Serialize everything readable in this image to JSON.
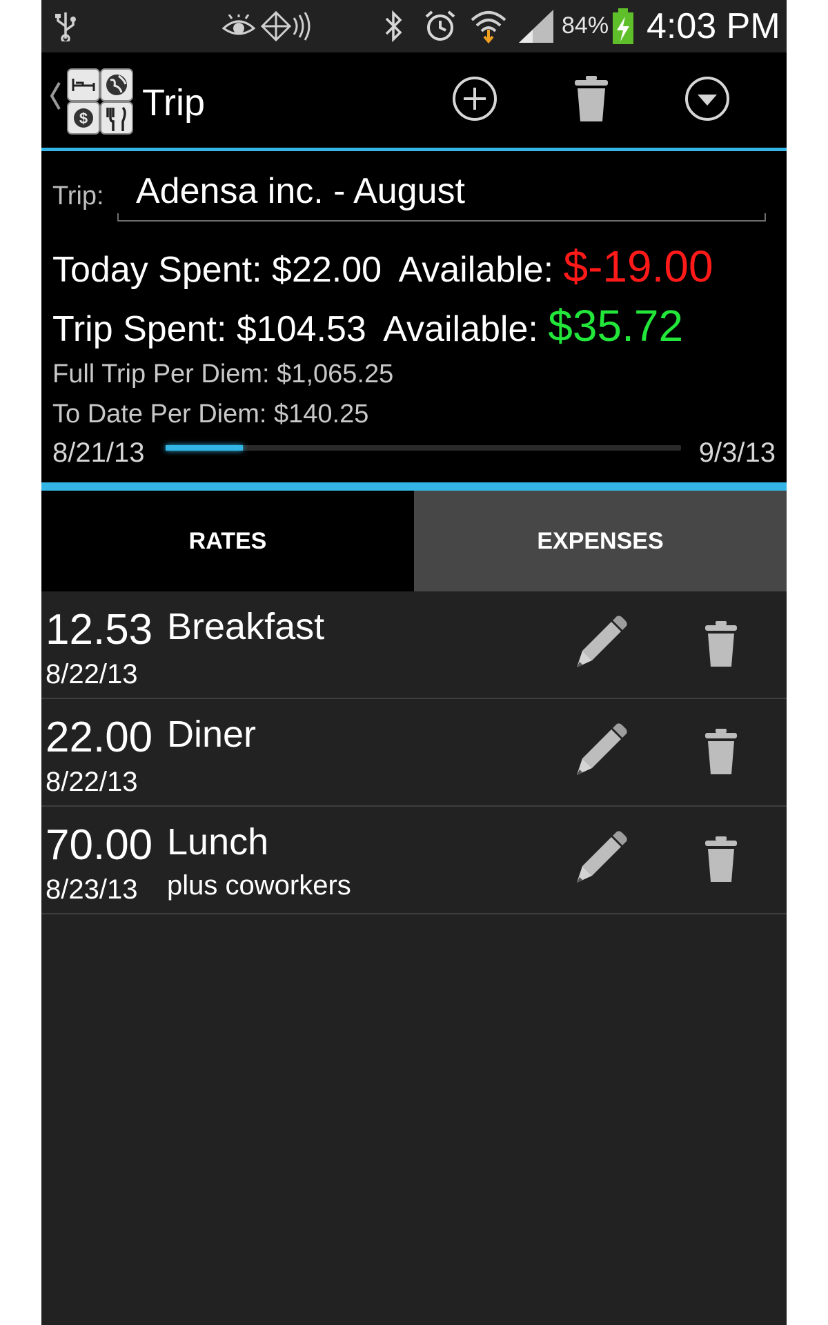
{
  "status_bar": {
    "battery_percent": "84%",
    "time": "4:03 PM",
    "icons": [
      "usb-icon",
      "eye-icon",
      "nfc-icon",
      "bluetooth-icon",
      "alarm-icon",
      "wifi-icon",
      "signal-icon",
      "battery-charging-icon"
    ]
  },
  "action_bar": {
    "title": "Trip",
    "icons": [
      "back-caret-icon",
      "app-logo-icon",
      "add-icon",
      "trash-icon",
      "dropdown-icon"
    ]
  },
  "trip": {
    "label": "Trip:",
    "name": "Adensa inc. - August"
  },
  "summary": {
    "today_spent_label": "Today Spent:",
    "today_spent": "$22.00",
    "today_available_label": "Available:",
    "today_available": "$-19.00",
    "trip_spent_label": "Trip Spent:",
    "trip_spent": "$104.53",
    "trip_available_label": "Available:",
    "trip_available": "$35.72",
    "full_trip_per_diem": "Full Trip Per Diem: $1,065.25",
    "to_date_per_diem": "To Date Per Diem: $140.25",
    "start_date": "8/21/13",
    "end_date": "9/3/13",
    "progress_fraction": 0.15
  },
  "colors": {
    "accent": "#33b5e5",
    "negative": "#ff1a1a",
    "positive": "#22e63a"
  },
  "tabs": [
    {
      "label": "RATES",
      "selected": false
    },
    {
      "label": "EXPENSES",
      "selected": true
    }
  ],
  "expenses": [
    {
      "amount": "12.53",
      "description": "Breakfast",
      "date": "8/22/13",
      "note": ""
    },
    {
      "amount": "22.00",
      "description": "Diner",
      "date": "8/22/13",
      "note": ""
    },
    {
      "amount": "70.00",
      "description": "Lunch",
      "date": "8/23/13",
      "note": "plus coworkers"
    }
  ]
}
